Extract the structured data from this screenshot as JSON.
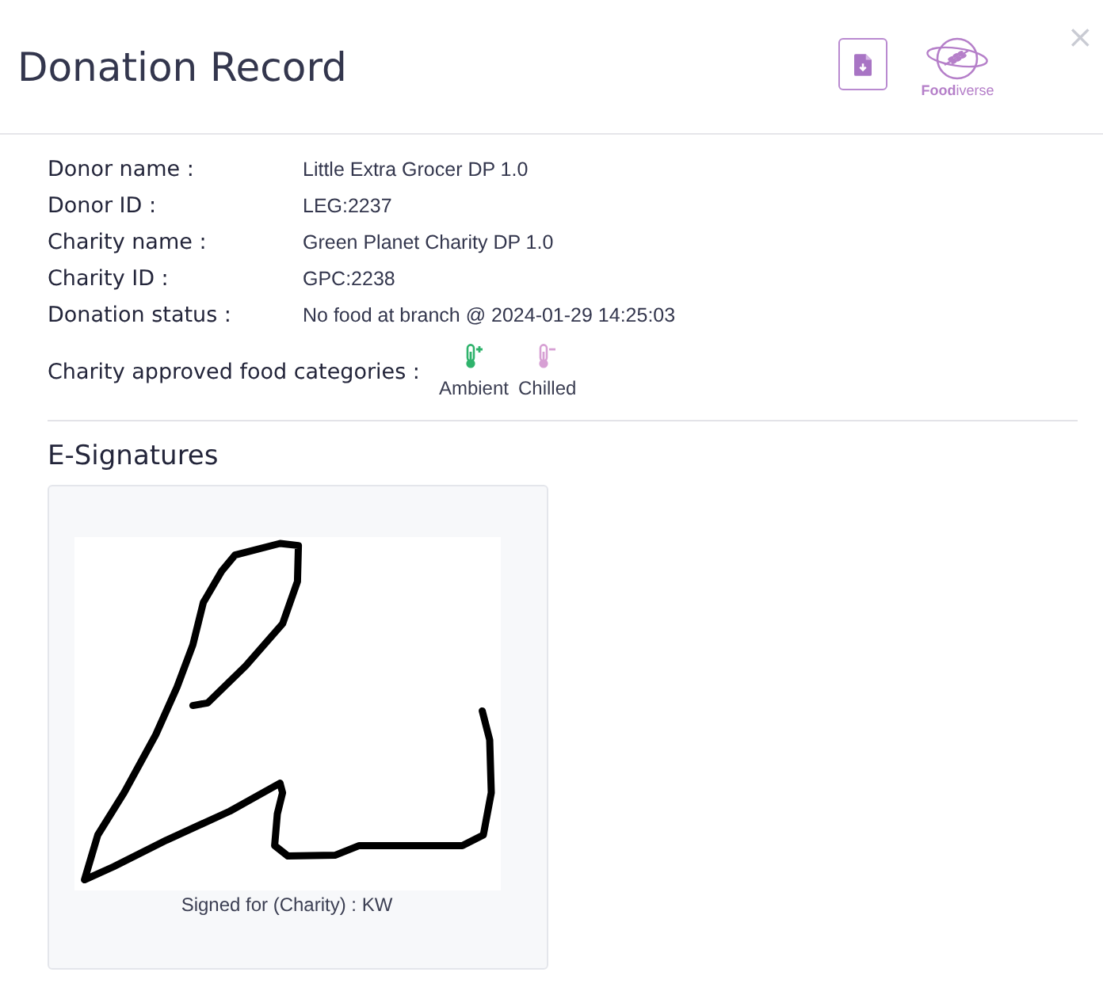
{
  "dialog": {
    "title": "Donation Record",
    "close": "×",
    "logo_text": "**Food**iverse"
  },
  "details": [
    {
      "label": "Donor name :",
      "value": "Little Extra Grocer DP 1.0"
    },
    {
      "label": "Donor ID :",
      "value": "LEG:2237"
    },
    {
      "label": "Charity name :",
      "value": "Green Planet Charity DP 1.0"
    },
    {
      "label": "Charity ID :",
      "value": "GPC:2238"
    },
    {
      "label": "Donation status :",
      "value": "No food at branch @ 2024-01-29 14:25:03"
    }
  ],
  "food_categories": {
    "label": "Charity approved food categories :",
    "items": [
      {
        "kind": "plus",
        "label": "Ambient",
        "color": "#2fb36c"
      },
      {
        "kind": "minus",
        "label": "Chilled",
        "color": "#d7a0d4"
      }
    ]
  },
  "signatures": {
    "title": "E-Signatures",
    "items": [
      {
        "caption": "Signed for (Charity) : KW"
      }
    ]
  }
}
